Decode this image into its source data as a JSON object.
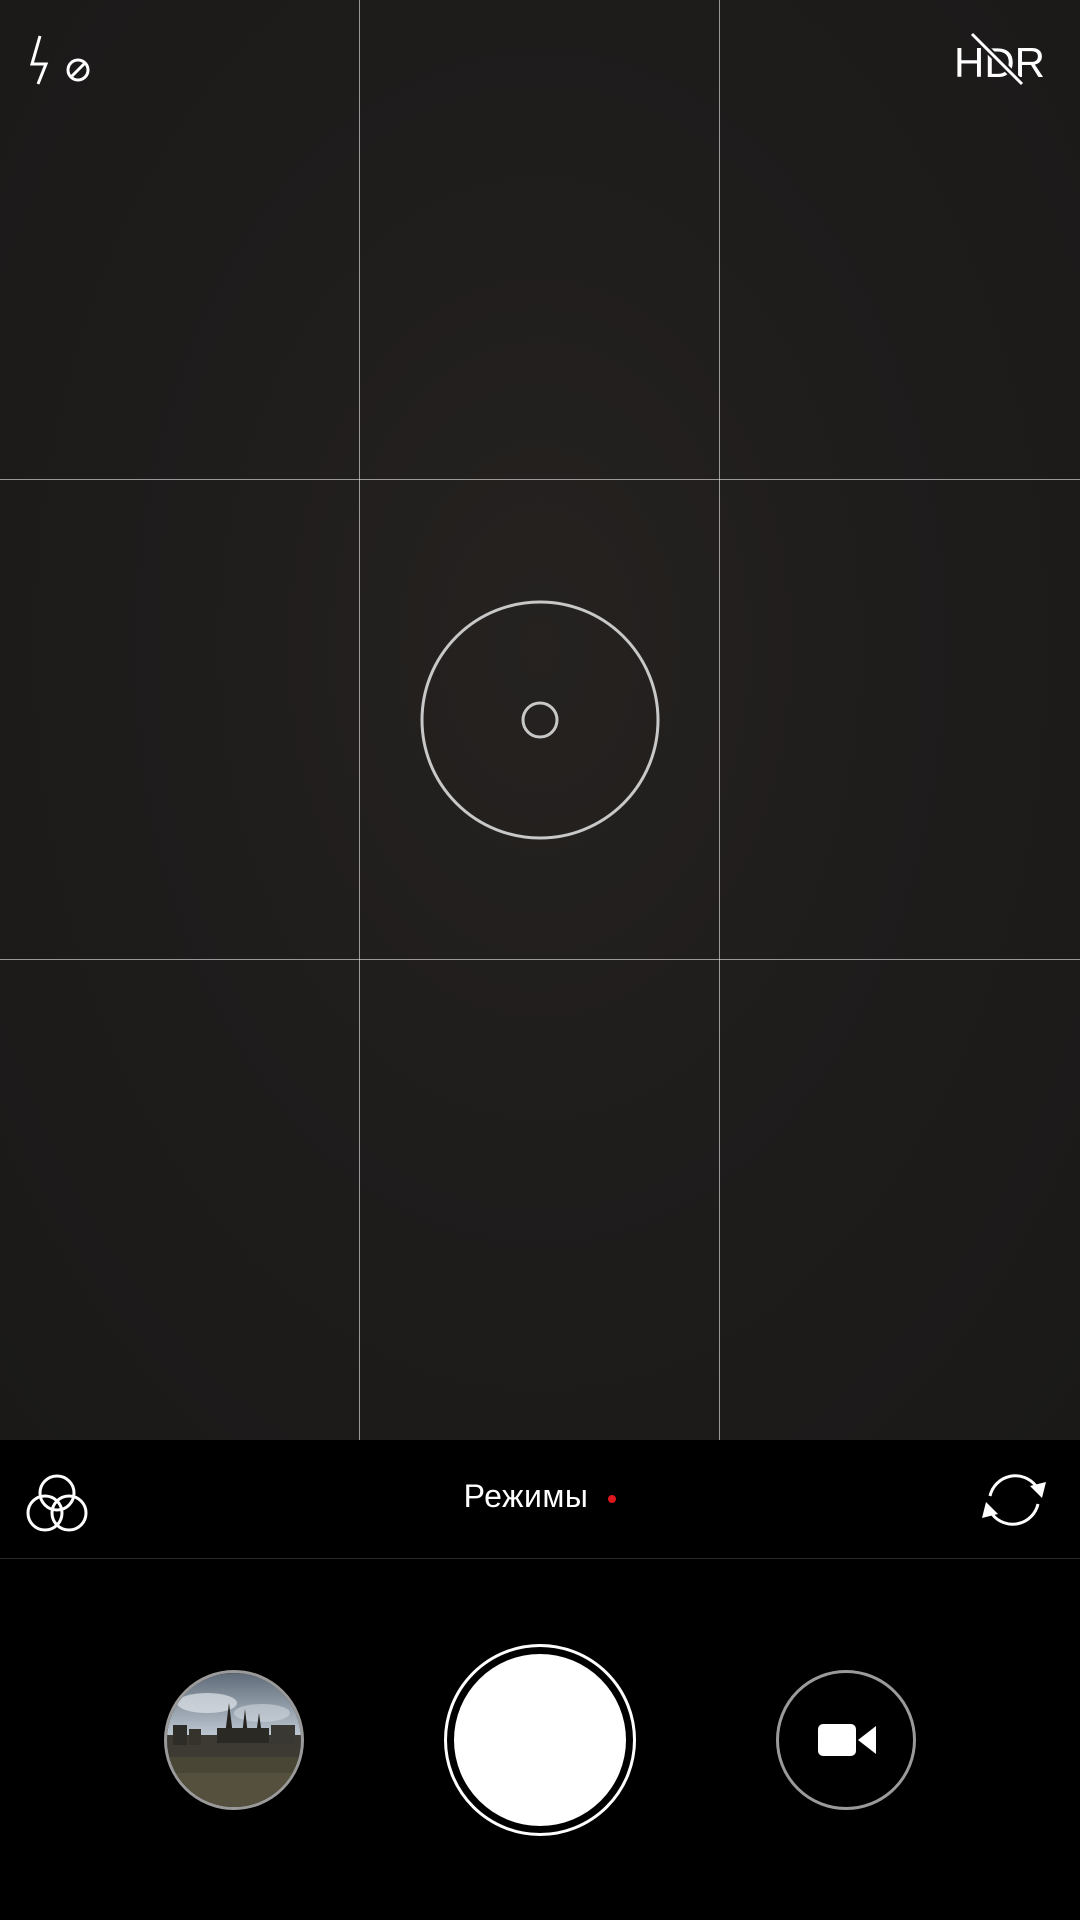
{
  "top_bar": {
    "flash_icon": "flash-off-icon",
    "hdr_icon": "hdr-off-icon",
    "hdr_label": "HDR"
  },
  "viewfinder": {
    "grid": "3x3",
    "focus_icon": "focus-ring-icon"
  },
  "mode_bar": {
    "filters_icon": "filters-icon",
    "modes_label": "Режимы",
    "modes_dot_color": "#e0161d",
    "switch_camera_icon": "switch-camera-icon"
  },
  "controls": {
    "gallery_icon": "gallery-thumbnail",
    "shutter_icon": "shutter-button",
    "video_icon": "video-camera-icon"
  },
  "colors": {
    "background": "#000000",
    "viewfinder": "#1f1d1c",
    "accent": "#e0161d",
    "icon": "#ffffff"
  }
}
